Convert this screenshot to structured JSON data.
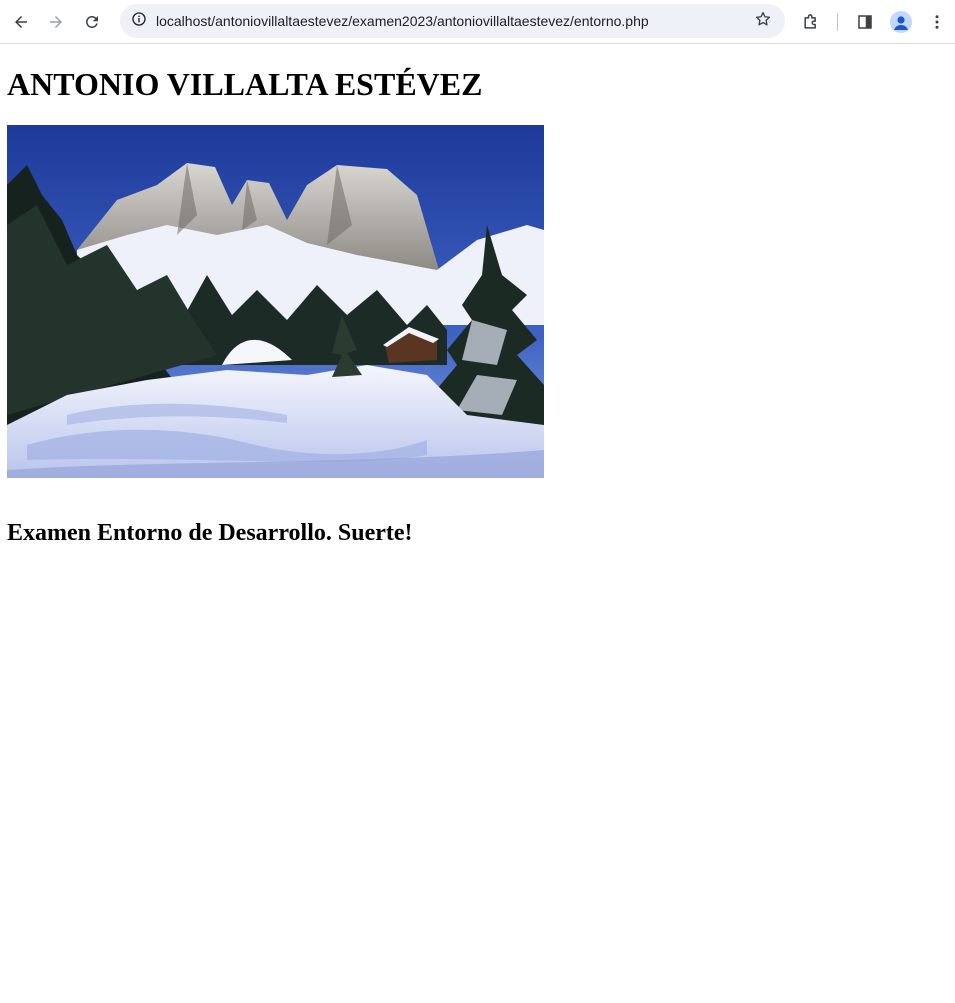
{
  "browser": {
    "url": "localhost/antoniovillaltaestevez/examen2023/antoniovillaltaestevez/entorno.php",
    "icons": [
      "back-arrow-icon",
      "forward-arrow-icon",
      "reload-icon",
      "site-info-icon",
      "bookmark-star-icon",
      "extensions-icon",
      "side-panel-icon",
      "profile-icon",
      "more-menu-icon"
    ]
  },
  "page": {
    "heading": "ANTONIO VILLALTA ESTÉVEZ",
    "image_subject": "snowy mountain landscape with pine trees and cabin",
    "subheading": "Examen Entorno de Desarrollo. Suerte!"
  }
}
